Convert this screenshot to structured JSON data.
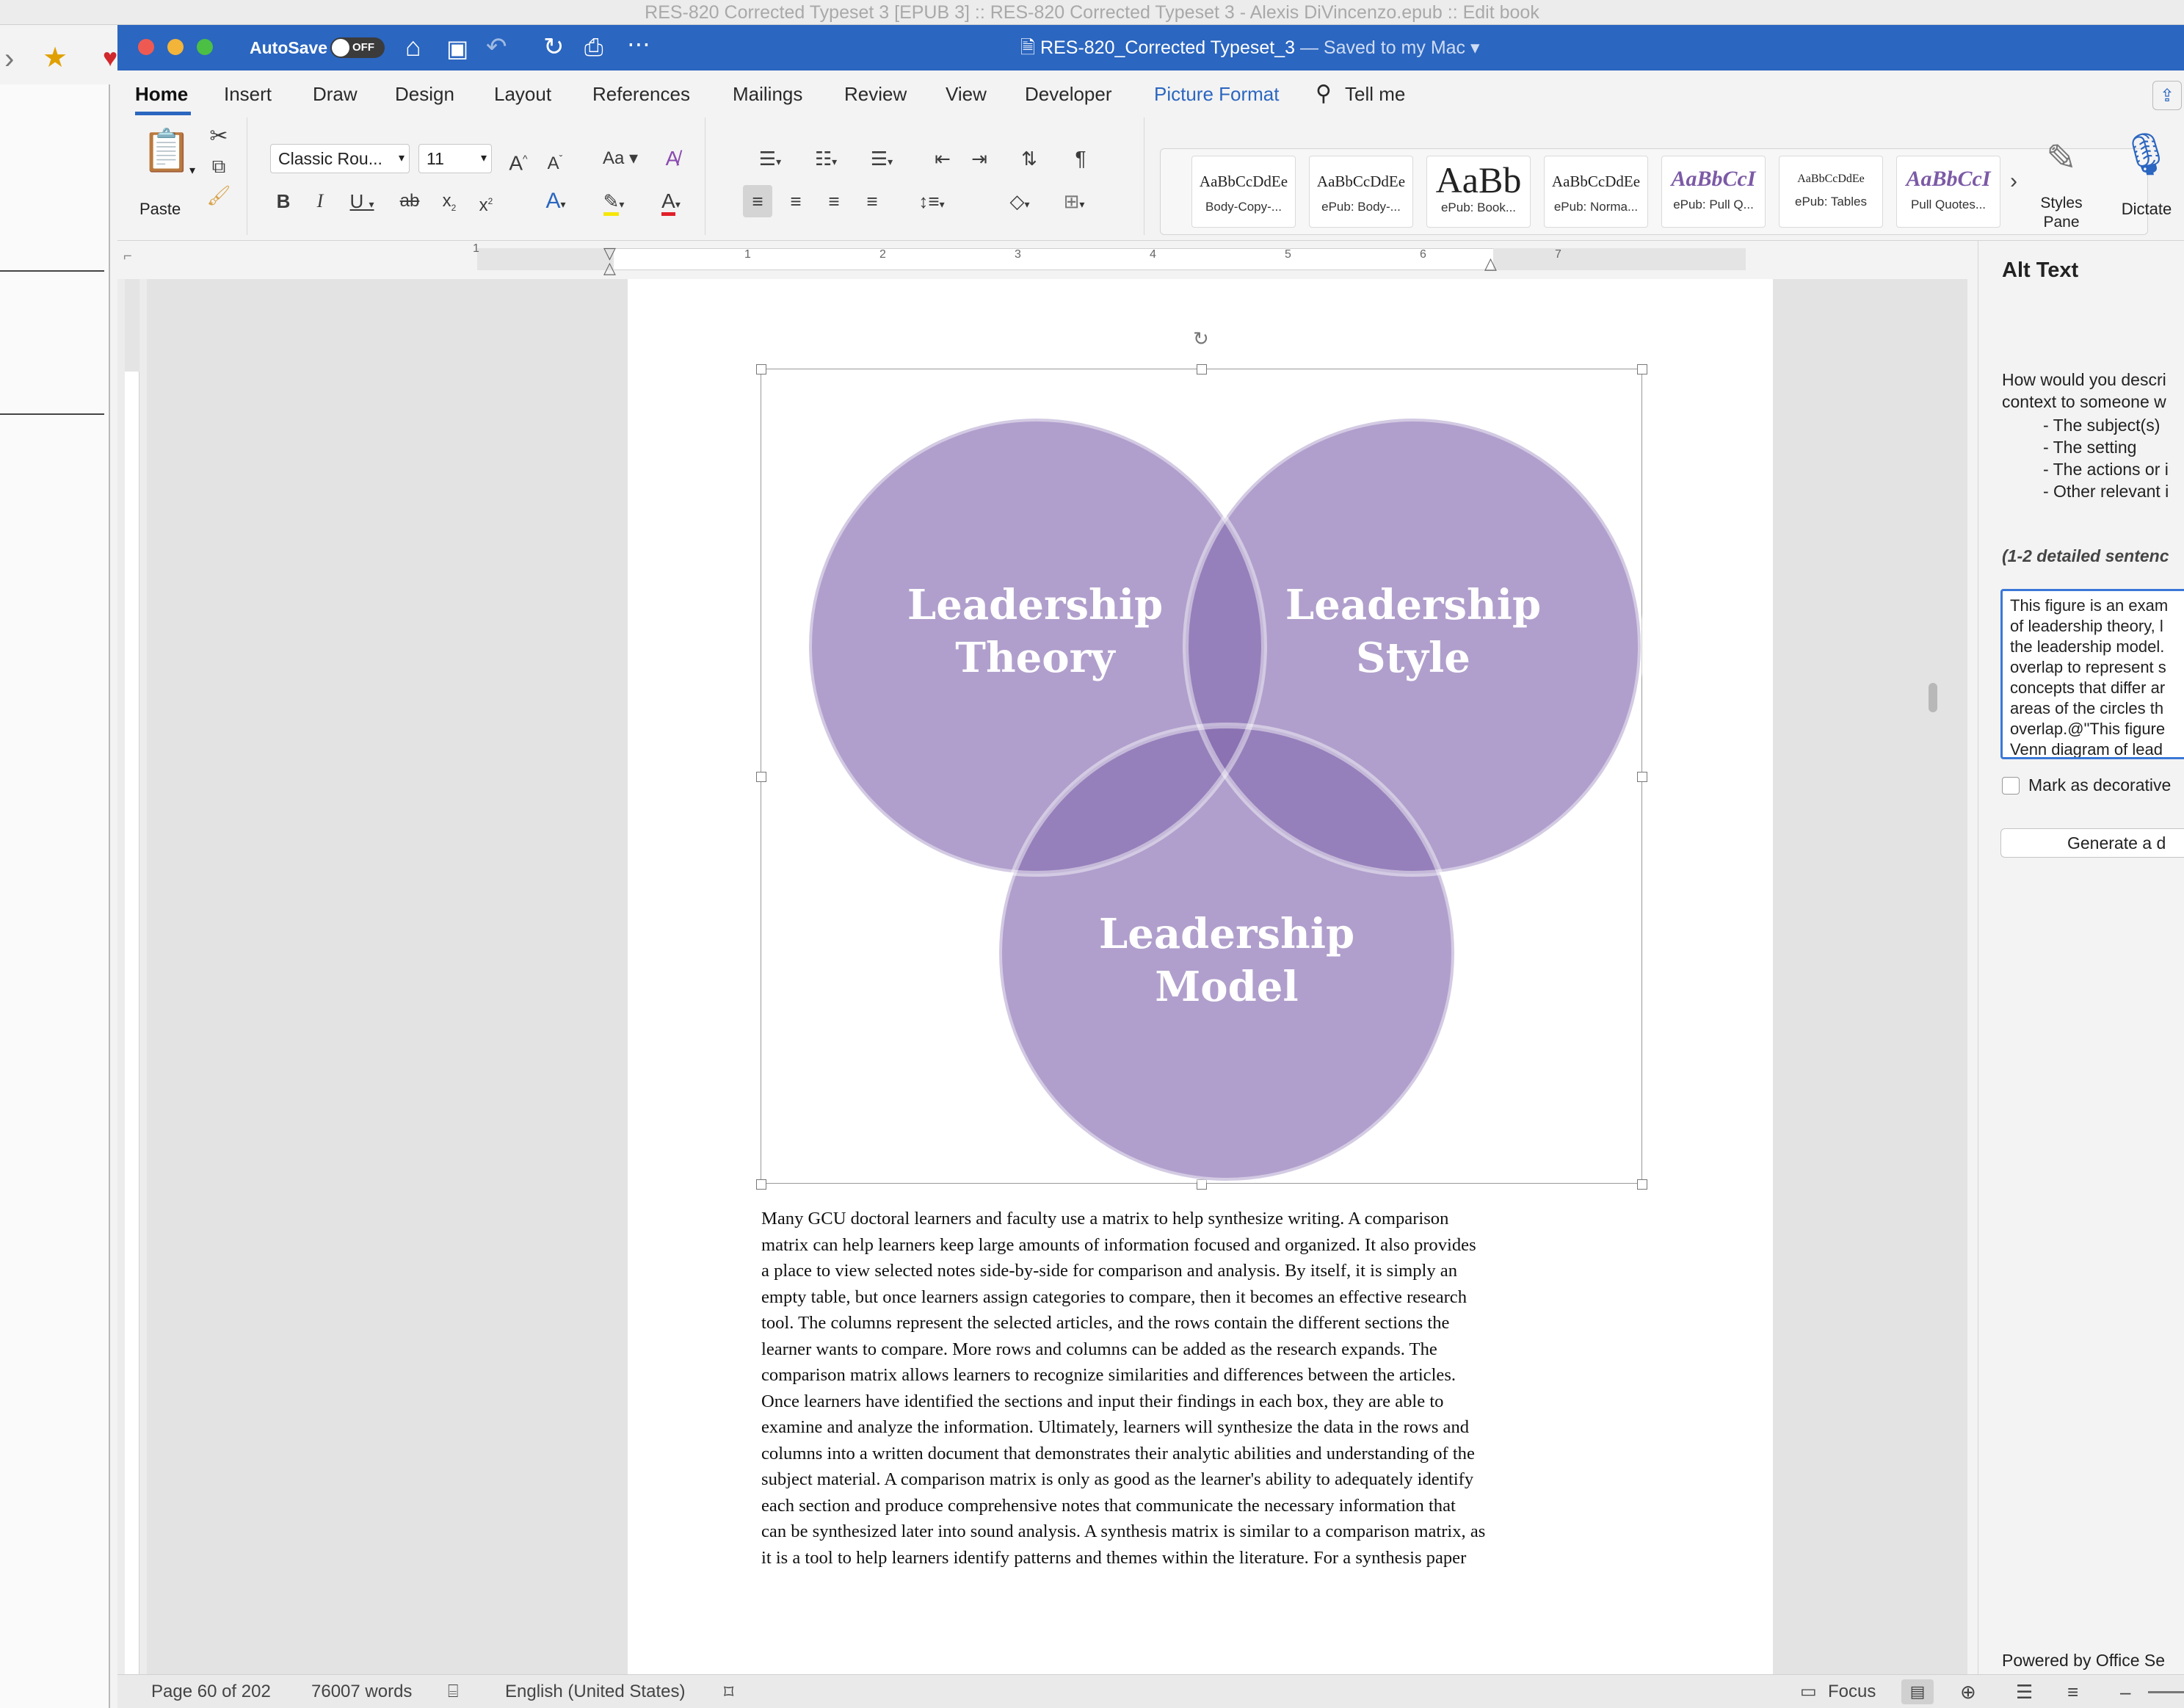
{
  "background_window": {
    "title": "RES-820 Corrected Typeset 3 [EPUB 3] :: RES-820 Corrected Typeset 3 - Alexis DiVincenzo.epub :: Edit book"
  },
  "titlebar": {
    "autosave_label": "AutoSave",
    "autosave_state": "OFF",
    "doc_title": "RES-820_Corrected Typeset_3",
    "save_status": "— Saved to my Mac"
  },
  "tabs": [
    "Home",
    "Insert",
    "Draw",
    "Design",
    "Layout",
    "References",
    "Mailings",
    "Review",
    "View",
    "Developer",
    "Picture Format",
    "Tell me"
  ],
  "ribbon": {
    "paste_label": "Paste",
    "font_name": "Classic Rou...",
    "font_size": "11",
    "styles": [
      {
        "preview": "AaBbCcDdEe",
        "name": "Body-Copy-..."
      },
      {
        "preview": "AaBbCcDdEe",
        "name": "ePub: Body-..."
      },
      {
        "preview": "AaBb",
        "name": "ePub: Book..."
      },
      {
        "preview": "AaBbCcDdEe",
        "name": "ePub: Norma..."
      },
      {
        "preview": "AaBbCcI",
        "name": "ePub: Pull Q..."
      },
      {
        "preview": "AaBbCcDdEe",
        "name": "ePub: Tables"
      },
      {
        "preview": "AaBbCcI",
        "name": "Pull Quotes..."
      }
    ],
    "styles_pane_label_1": "Styles",
    "styles_pane_label_2": "Pane",
    "dictate_label": "Dictate"
  },
  "ruler": {
    "numbers": [
      "1",
      "1",
      "2",
      "3",
      "4",
      "5",
      "6",
      "7"
    ]
  },
  "venn": {
    "circle_color": "#b09fcc",
    "overlap_color": "#9680bb",
    "center_color": "#8a72b3",
    "circles": [
      {
        "line1": "Leadership",
        "line2": "Theory"
      },
      {
        "line1": "Leadership",
        "line2": "Style"
      },
      {
        "line1": "Leadership",
        "line2": "Model"
      }
    ]
  },
  "body_lines": [
    "Many GCU doctoral learners and faculty use a matrix to help synthesize writing. A comparison",
    "matrix can help learners keep large amounts of information focused and organized. It also provides",
    "a place to view selected notes side-by-side for comparison and analysis. By itself, it is simply an",
    "empty table, but once learners assign categories to compare, then it becomes an effective research",
    "tool. The columns represent the selected articles, and the rows contain the different sections the",
    "learner wants to compare. More rows and columns can be added as the research expands. The",
    "comparison matrix allows learners to recognize similarities and differences between the articles.",
    "Once learners have identified the sections and input their findings in each box, they are able to",
    "examine and analyze the information. Ultimately, learners will synthesize the data in the rows and",
    "columns into a written document that demonstrates their analytic abilities and understanding of the",
    "subject material. A comparison matrix is only as good as the learner's ability to adequately identify",
    "each section and produce comprehensive notes that communicate the necessary information that",
    "can be synthesized later into sound analysis. A synthesis matrix is similar to a comparison matrix, as",
    "it is a tool to help learners identify patterns and themes within the literature. For a synthesis paper"
  ],
  "alt_pane": {
    "title": "Alt Text",
    "question_1": "How would you descri",
    "question_2": "context to someone w",
    "bullets": [
      "- The subject(s)",
      "- The setting",
      "- The actions or i",
      "- Other relevant i"
    ],
    "hint": "(1-2 detailed sentenc",
    "textarea_lines": [
      "This figure is an exam",
      "of leadership theory, l",
      "the leadership model.",
      "overlap to represent s",
      "concepts that differ ar",
      "areas of the circles th",
      "overlap.@\"This figure",
      "Venn diagram of lead"
    ],
    "decorative_label": "Mark as decorative",
    "generate_label": "Generate a d",
    "powered_by": "Powered by Office Se"
  },
  "status": {
    "page": "Page 60 of 202",
    "words": "76007 words",
    "language": "English (United States)",
    "focus": "Focus"
  }
}
